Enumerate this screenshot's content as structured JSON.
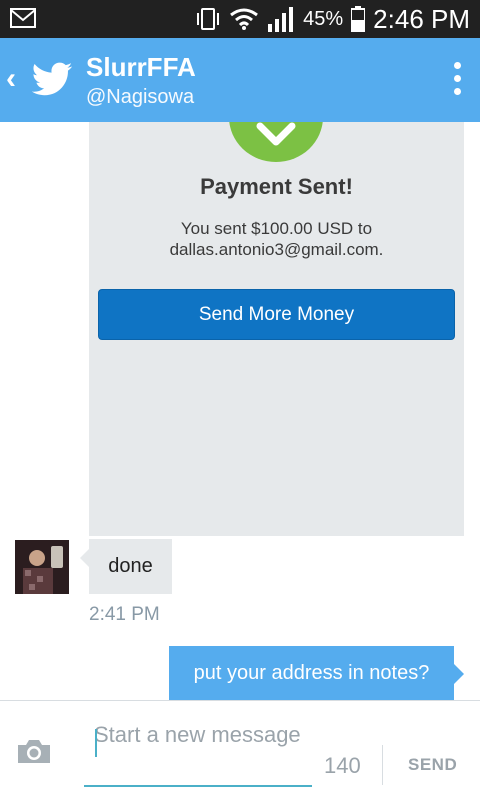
{
  "status_bar": {
    "battery_percent": "45%",
    "time": "2:46 PM"
  },
  "header": {
    "name": "SlurrFFA",
    "handle": "@Nagisowa"
  },
  "conversation": {
    "shared_image": {
      "title": "Payment Sent!",
      "description_line1": "You sent $100.00 USD to",
      "description_line2": "dallas.antonio3@gmail.com.",
      "button_label": "Send More Money"
    },
    "incoming_message": "done",
    "incoming_timestamp": "2:41 PM",
    "outgoing_message": "put your address in notes?"
  },
  "compose": {
    "placeholder": "Start a new message",
    "char_count": "140",
    "send_label": "SEND"
  },
  "colors": {
    "header": "#55acee",
    "status_bar": "#212121",
    "check_green": "#7cc144",
    "pay_button": "#0f74c4"
  }
}
